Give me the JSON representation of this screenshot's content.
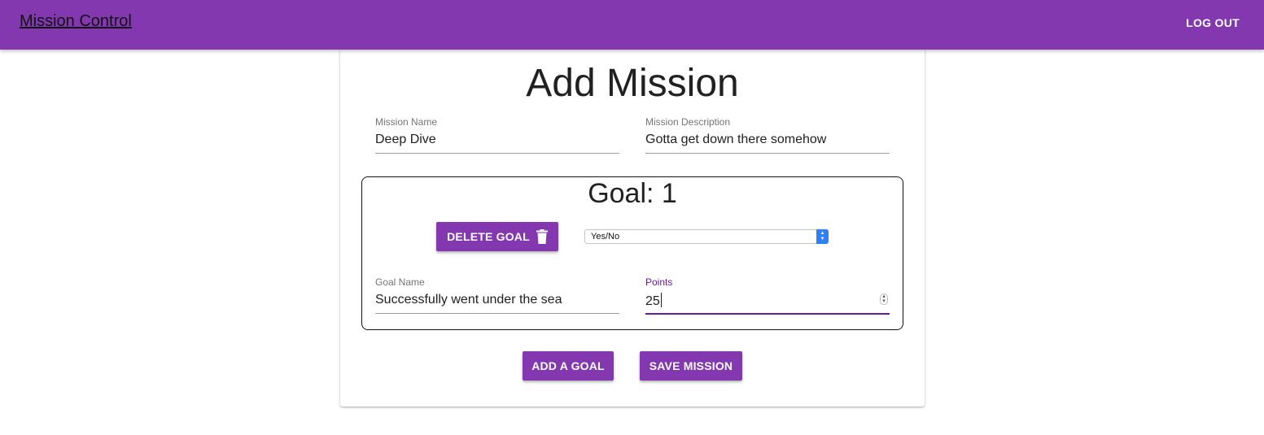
{
  "colors": {
    "brand": "#8438b0",
    "accent_dark": "#6a1b9a"
  },
  "header": {
    "app_title": "Mission Control",
    "logout_label": "LOG OUT"
  },
  "form": {
    "page_title": "Add Mission",
    "mission_name": {
      "label": "Mission Name",
      "value": "Deep Dive"
    },
    "mission_description": {
      "label": "Mission Description",
      "value": "Gotta get down there somehow"
    }
  },
  "goal": {
    "title": "Goal: 1",
    "delete_label": "DELETE GOAL",
    "delete_icon": "trash-icon",
    "type_select": {
      "selected": "Yes/No"
    },
    "goal_name": {
      "label": "Goal Name",
      "value": "Successfully went under the sea"
    },
    "points": {
      "label": "Points",
      "value": "25"
    }
  },
  "actions": {
    "add_goal_label": "ADD A GOAL",
    "save_mission_label": "SAVE MISSION"
  }
}
